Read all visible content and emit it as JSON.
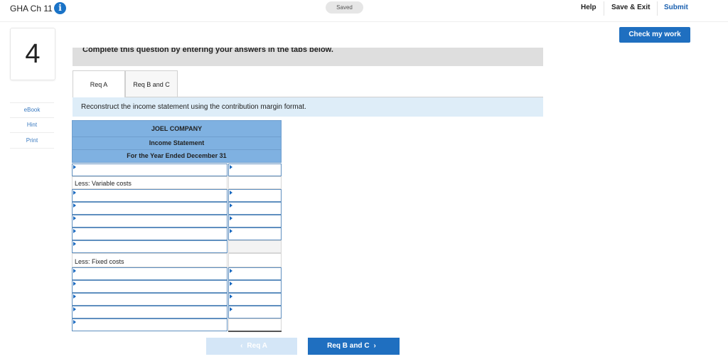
{
  "header": {
    "title": "GHA Ch 11",
    "info_icon": "info-icon",
    "saved_label": "Saved",
    "help_label": "Help",
    "save_exit_label": "Save & Exit",
    "submit_label": "Submit"
  },
  "check_work_label": "Check my work",
  "question_number": "4",
  "sidebar": {
    "items": [
      {
        "label": "eBook"
      },
      {
        "label": "Hint"
      },
      {
        "label": "Print"
      }
    ]
  },
  "instructions": "Complete this question by entering your answers in the tabs below.",
  "tabs": [
    {
      "label": "Req A",
      "active": true
    },
    {
      "label": "Req B and C",
      "active": false
    }
  ],
  "prompt": "Reconstruct the income statement using the contribution margin format.",
  "statement": {
    "company": "JOEL COMPANY",
    "title": "Income Statement",
    "period": "For the Year Ended December 31",
    "rows": [
      {
        "label": "",
        "value": ""
      },
      {
        "label": "Less: Variable costs",
        "value": ""
      },
      {
        "label": "",
        "value": ""
      },
      {
        "label": "",
        "value": ""
      },
      {
        "label": "",
        "value": ""
      },
      {
        "label": "",
        "value": ""
      },
      {
        "label": "",
        "value": ""
      },
      {
        "label": "Less: Fixed costs",
        "value": ""
      },
      {
        "label": "",
        "value": ""
      },
      {
        "label": "",
        "value": ""
      },
      {
        "label": "",
        "value": ""
      },
      {
        "label": "",
        "value": ""
      },
      {
        "label": "",
        "value": ""
      }
    ]
  },
  "nav": {
    "prev_label": "Req A",
    "next_label": "Req B and C"
  },
  "colors": {
    "accent": "#1f6fc0",
    "table_header": "#7fb1e1",
    "prompt_band": "#deedf8"
  }
}
